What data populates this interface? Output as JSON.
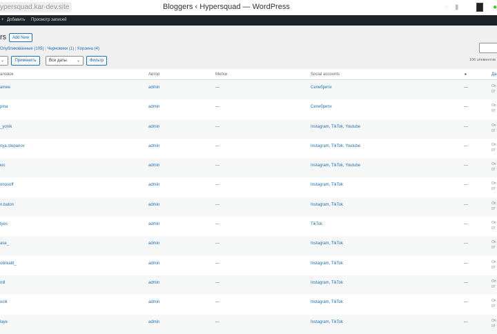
{
  "browser": {
    "url": "ypersquad.kar-dev.site",
    "title": "Bloggers ‹ Hypersquad — WordPress"
  },
  "adminbar": {
    "add": "Добавить",
    "view": "Просмотр записей"
  },
  "page": {
    "title": "rs",
    "add_new": "Add New"
  },
  "filters": {
    "published": "Опубликованные (105)",
    "drafts": "Черновики (1)",
    "trash": "Корзина (4)",
    "apply": "Применить",
    "dates": "Все даты",
    "filter": "Фильтр",
    "count": "106 элементов"
  },
  "columns": {
    "title": "аловок",
    "author": "Автор",
    "tags": "Метки",
    "social": "Social accounts",
    "date": "Да"
  },
  "rows": [
    {
      "title": "amee",
      "author": "admin",
      "tags": "—",
      "social": "Селебрити",
      "comments": "—",
      "date1": "Оп",
      "date2": "07"
    },
    {
      "title": "pina",
      "author": "admin",
      "tags": "—",
      "social": "Селебрити",
      "comments": "—",
      "date1": "Оп",
      "date2": "07"
    },
    {
      "title": "_yonik",
      "author": "admin",
      "tags": "—",
      "social": "Instagram, TikTok, Youtube",
      "comments": "—",
      "date1": "Оп",
      "date2": "07"
    },
    {
      "title": "nya.stepanov",
      "author": "admin",
      "tags": "—",
      "social": "Instagram, TikTok, Youtube",
      "comments": "—",
      "date1": "Оп",
      "date2": "07"
    },
    {
      "title": "юс",
      "author": "admin",
      "tags": "—",
      "social": "Instagram, TikTok, Youtube",
      "comments": "—",
      "date1": "Оп",
      "date2": "07"
    },
    {
      "title": "onosoff",
      "author": "admin",
      "tags": "—",
      "social": "Instagram, TikTok",
      "comments": "—",
      "date1": "Оп",
      "date2": "07"
    },
    {
      "title": "n.baton",
      "author": "admin",
      "tags": "—",
      "social": "Instagram, TikTok",
      "comments": "—",
      "date1": "Оп",
      "date2": "07"
    },
    {
      "title": "tyes",
      "author": "admin",
      "tags": "—",
      "social": "TikTok",
      "comments": "—",
      "date1": "Оп",
      "date2": "07"
    },
    {
      "title": "ase_",
      "author": "admin",
      "tags": "—",
      "social": "Instagram, TikTok",
      "comments": "—",
      "date1": "Оп",
      "date2": "07"
    },
    {
      "title": "olinkaitt_",
      "author": "admin",
      "tags": "—",
      "social": "Instagram, TikTok",
      "comments": "—",
      "date1": "Оп",
      "date2": "07"
    },
    {
      "title": "nill",
      "author": "admin",
      "tags": "—",
      "social": "Instagram, TikTok",
      "comments": "—",
      "date1": "Оп",
      "date2": "07"
    },
    {
      "title": "ucik",
      "author": "admin",
      "tags": "—",
      "social": "Instagram, TikTok",
      "comments": "—",
      "date1": "Оп",
      "date2": "07"
    },
    {
      "title": "laye",
      "author": "admin",
      "tags": "—",
      "social": "Instagram, TikTok",
      "comments": "—",
      "date1": "Оп",
      "date2": "07"
    }
  ]
}
